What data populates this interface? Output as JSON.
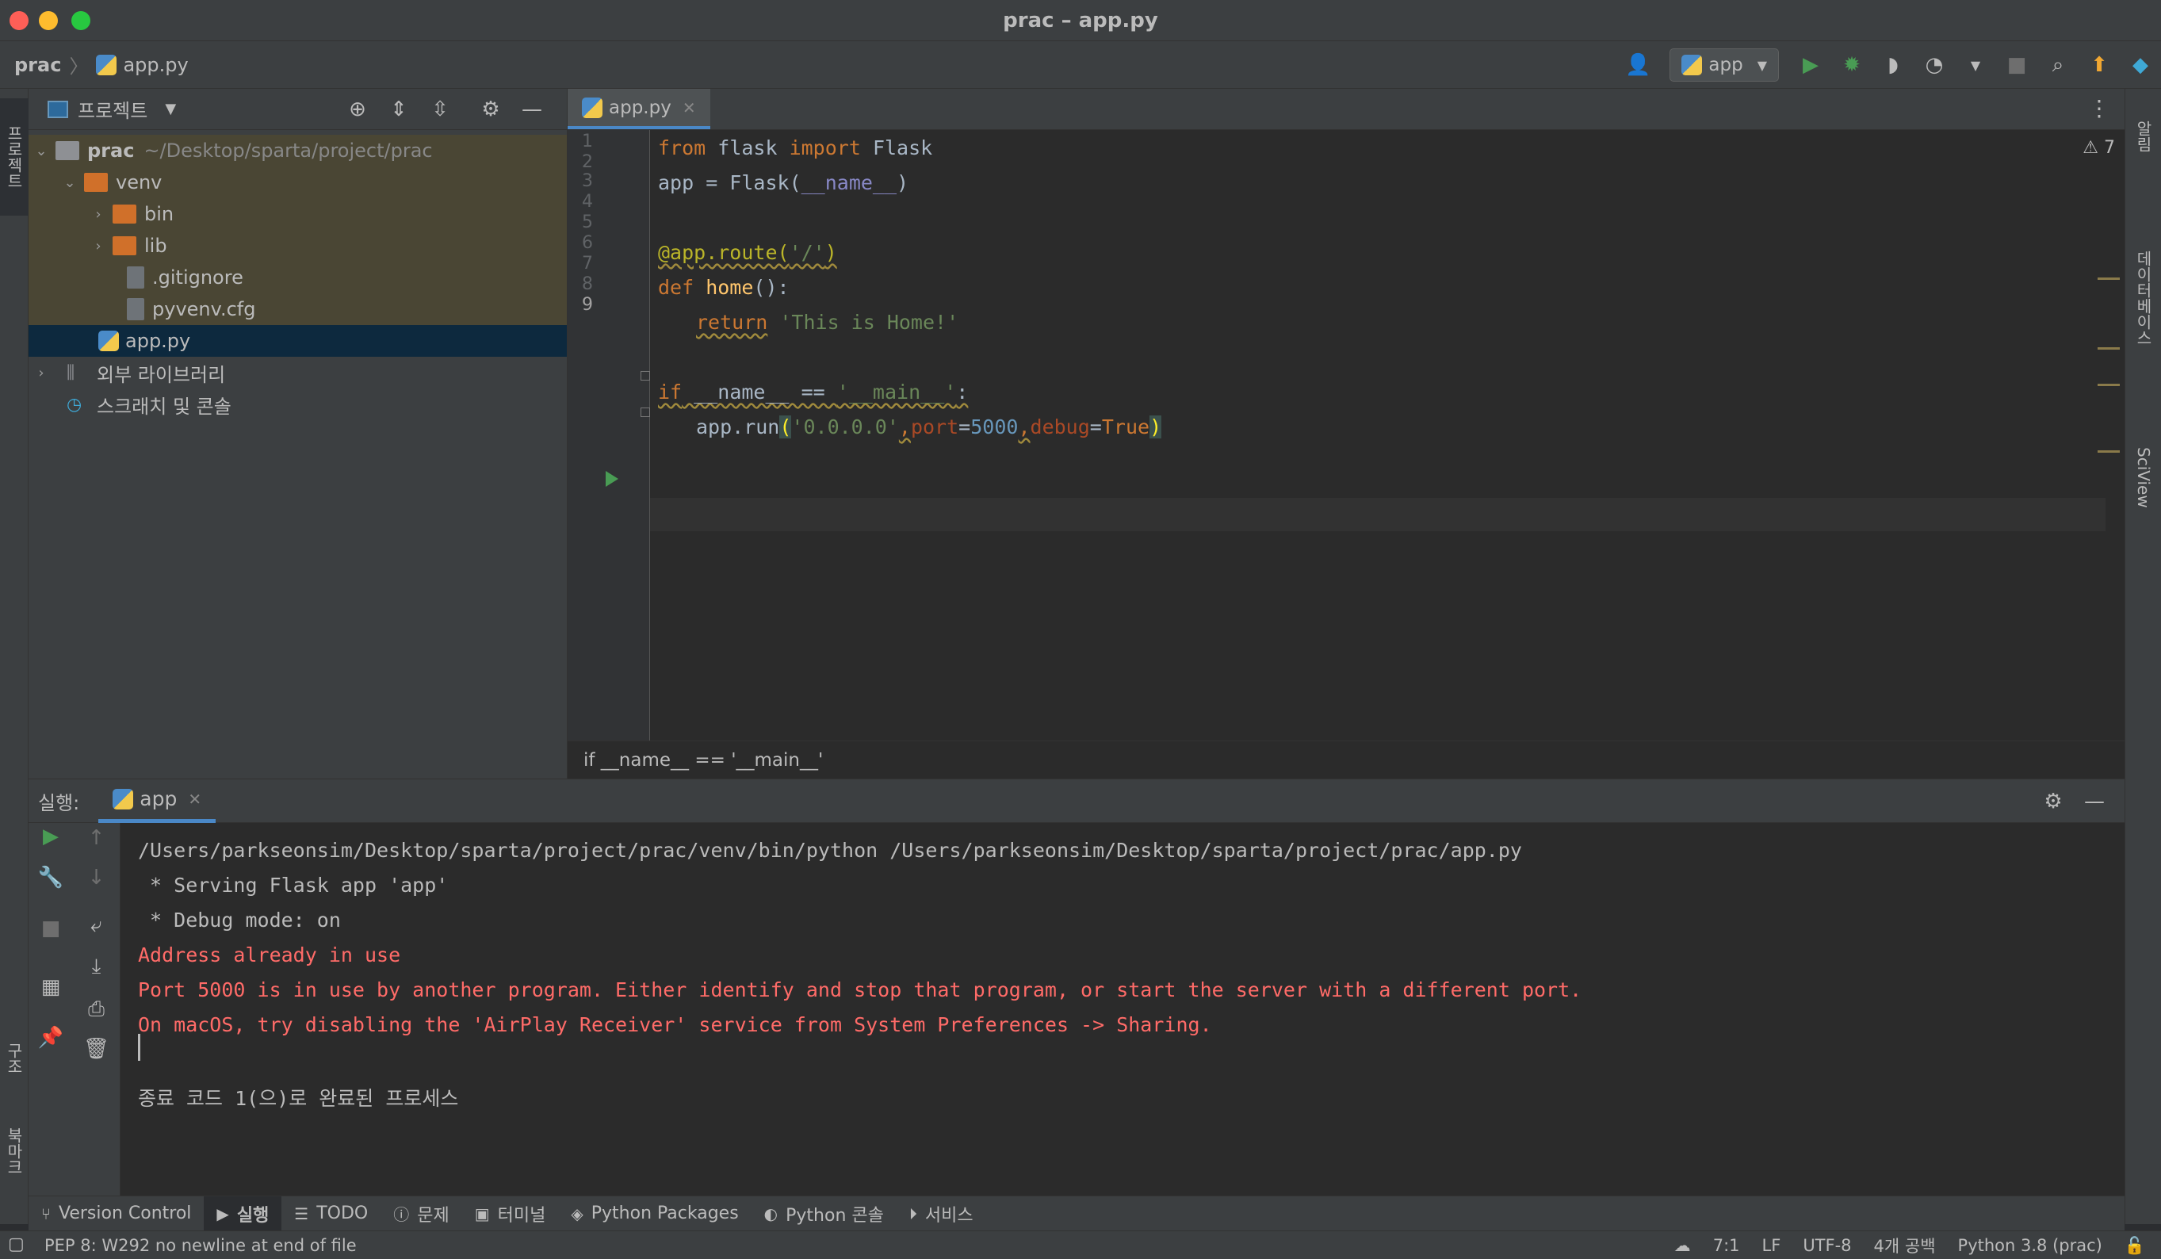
{
  "window": {
    "title": "prac – app.py"
  },
  "navbar": {
    "project": "prac",
    "file": "app.py",
    "run_config": "app"
  },
  "left_strip": {
    "project_tab": "프로젝트",
    "structure_tab": "구조",
    "bookmarks_tab": "북마크"
  },
  "right_strip": {
    "notifications_tab": "알림",
    "database_tab": "데이터베이스",
    "sciview_tab": "SciView"
  },
  "project_panel": {
    "title": "프로젝트",
    "tree": [
      {
        "name": "prac",
        "path": "~/Desktop/sparta/project/prac"
      },
      {
        "name": "venv"
      },
      {
        "name": "bin"
      },
      {
        "name": "lib"
      },
      {
        "name": ".gitignore"
      },
      {
        "name": "pyvenv.cfg"
      },
      {
        "name": "app.py"
      },
      {
        "name": "외부 라이브러리"
      },
      {
        "name": "스크래치 및 콘솔"
      }
    ]
  },
  "editor": {
    "tab": "app.py",
    "warning_count": "7",
    "line_numbers": [
      "1",
      "2",
      "3",
      "4",
      "5",
      "6",
      "7",
      "8",
      "9"
    ],
    "code": {
      "l1": {
        "from": "from",
        "mod": " flask ",
        "imp": "import",
        "cls": " Flask"
      },
      "l2": {
        "a": "app = Flask(",
        "name": "__name__",
        "b": ")"
      },
      "l4": {
        "deco": "@app.route(",
        "arg": "'/'",
        "end": ")"
      },
      "l5": {
        "def": "def",
        "fn": " home",
        "rest": "():"
      },
      "l6": {
        "ret": "return",
        "str": " 'This is Home!'"
      },
      "l8": {
        "if": "if",
        "rest1": " __name__ == ",
        "str": "'__main__'",
        "rest2": ":"
      },
      "l9": {
        "a": "app.run",
        "po": "(",
        "s": "'0.0.0.0'",
        "c1": ",",
        "p1": "port",
        "eq1": "=",
        "n": "5000",
        "c2": ",",
        "p2": "debug",
        "eq2": "=",
        "t": "True",
        "pc": ")"
      }
    },
    "breadcrumb": "if __name__ == '__main__'"
  },
  "run_panel": {
    "label": "실행:",
    "tab": "app",
    "output": [
      "/Users/parkseonsim/Desktop/sparta/project/prac/venv/bin/python /Users/parkseonsim/Desktop/sparta/project/prac/app.py",
      " * Serving Flask app 'app'",
      " * Debug mode: on",
      "Address already in use",
      "Port 5000 is in use by another program. Either identify and stop that program, or start the server with a different port.",
      "On macOS, try disabling the 'AirPlay Receiver' service from System Preferences -> Sharing.",
      "종료 코드 1(으)로 완료된 프로세스"
    ]
  },
  "tool_tabs": [
    {
      "label": "Version Control"
    },
    {
      "label": "실행"
    },
    {
      "label": "TODO"
    },
    {
      "label": "문제"
    },
    {
      "label": "터미널"
    },
    {
      "label": "Python Packages"
    },
    {
      "label": "Python 콘솔"
    },
    {
      "label": "서비스"
    }
  ],
  "status_bar": {
    "message": "PEP 8: W292 no newline at end of file",
    "position": "7:1",
    "line_sep": "LF",
    "encoding": "UTF-8",
    "indent": "4개 공백",
    "interpreter": "Python 3.8 (prac)"
  },
  "colors": {
    "accent": "#4a88c7",
    "error": "#ff6b68",
    "run_green": "#499c54"
  }
}
